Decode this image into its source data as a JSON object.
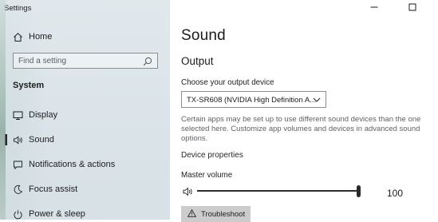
{
  "window": {
    "title": "Settings",
    "controls": {
      "minimize": "minimize-icon",
      "maximize": "maximize-icon"
    }
  },
  "sidebar": {
    "home_label": "Home",
    "search_placeholder": "Find a setting",
    "section_title": "System",
    "items": [
      {
        "label": "Display",
        "icon": "monitor-icon",
        "selected": false
      },
      {
        "label": "Sound",
        "icon": "speaker-icon",
        "selected": true
      },
      {
        "label": "Notifications & actions",
        "icon": "notification-icon",
        "selected": false
      },
      {
        "label": "Focus assist",
        "icon": "moon-icon",
        "selected": false
      },
      {
        "label": "Power & sleep",
        "icon": "power-icon",
        "selected": false
      }
    ]
  },
  "main": {
    "title": "Sound",
    "output": {
      "heading": "Output",
      "device_label": "Choose your output device",
      "device_value": "TX-SR608 (NVIDIA High Definition A...",
      "helper_text": "Certain apps may be set up to use different sound devices than the one selected here. Customize app volumes and devices in advanced sound options.",
      "device_properties_link": "Device properties",
      "master_volume_label": "Master volume",
      "volume_value": "100",
      "volume_level": 1.0,
      "troubleshoot_label": "Troubleshoot"
    }
  },
  "colors": {
    "accent": "#2b2b2b",
    "sidebar_bg": "#dfe6ea",
    "helper_text": "#5f6368",
    "button_bg": "#cccccc"
  }
}
